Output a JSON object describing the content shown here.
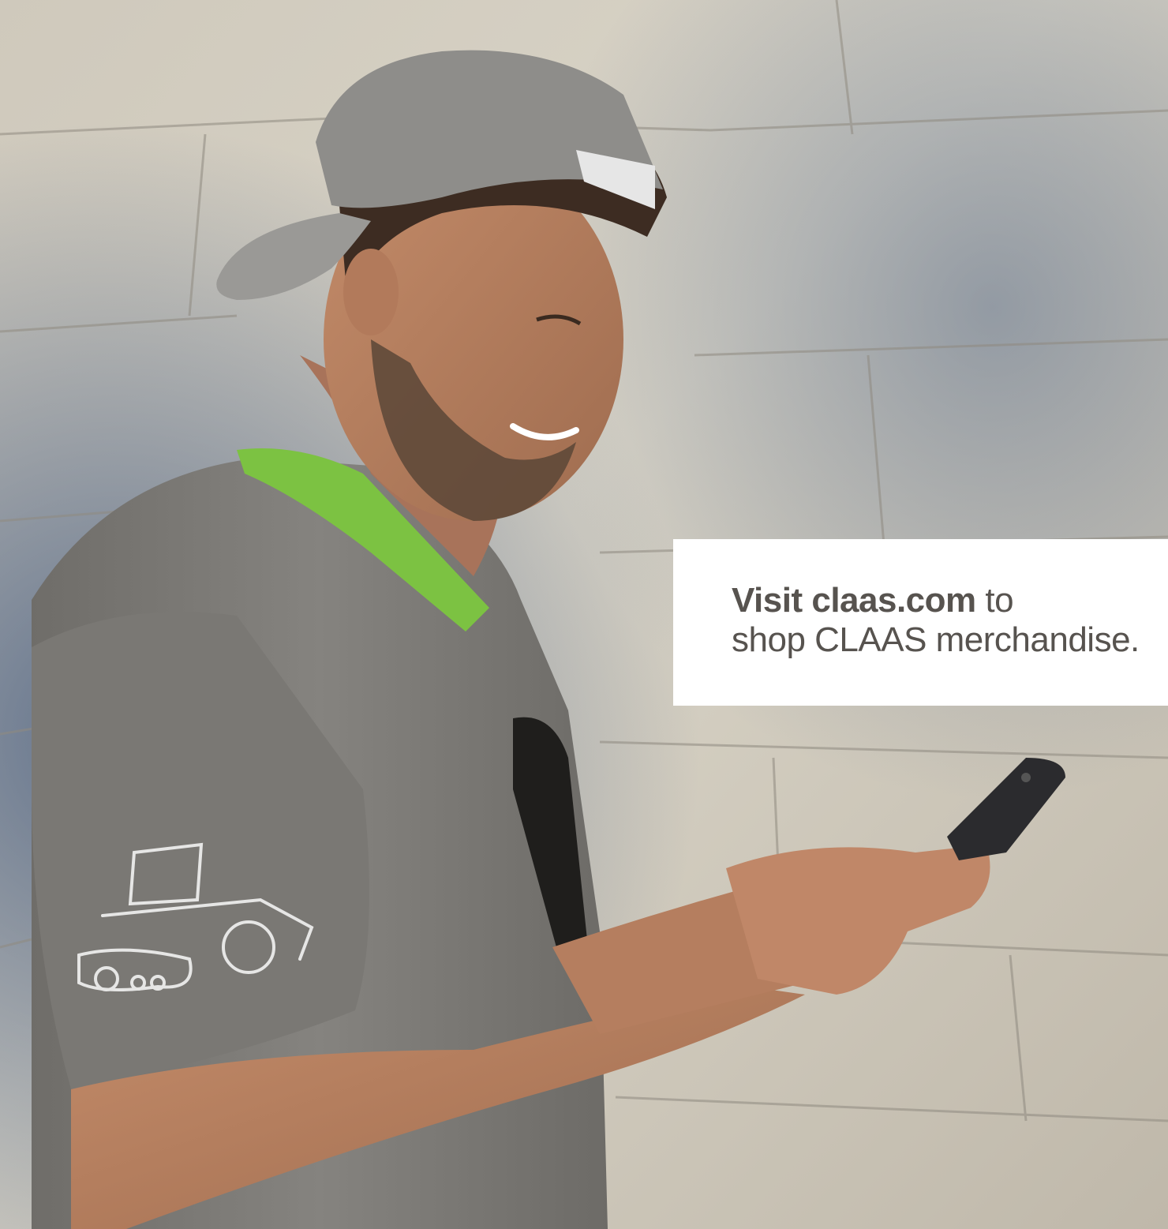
{
  "callout": {
    "link_text": "Visit claas.com",
    "line1_rest": " to",
    "line2": "shop CLAAS merchandise."
  },
  "photo": {
    "subject": "man-with-phone",
    "colors": {
      "wall_light": "#d8d3c8",
      "wall_blue": "#5f6f86",
      "shirt": "#7f7d79",
      "collar": "#7cc242",
      "cap": "#8e8d8a",
      "skin": "#b57e5f",
      "phone": "#2b2b2e"
    }
  }
}
